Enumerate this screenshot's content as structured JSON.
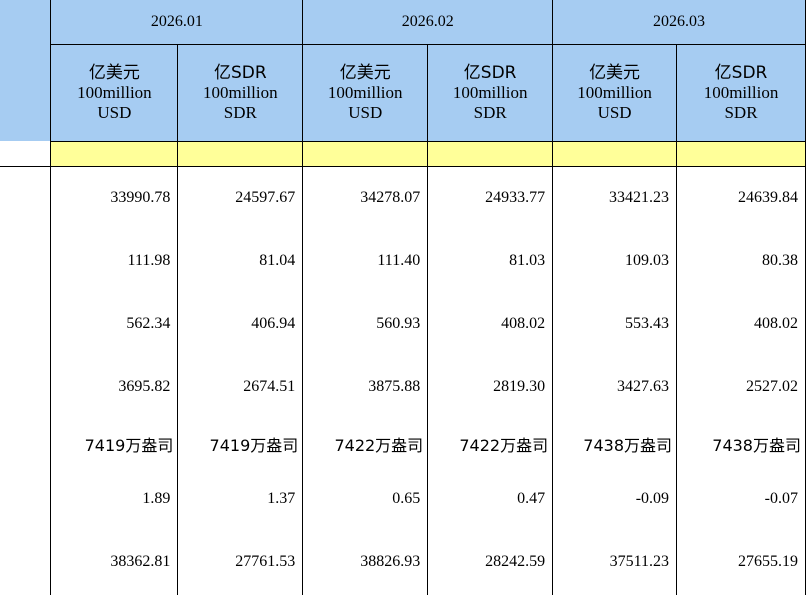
{
  "periods": [
    "2026.01",
    "2026.02",
    "2026.03"
  ],
  "units": {
    "usd": {
      "cn": "亿美元",
      "en1": "100million",
      "en2": "USD"
    },
    "sdr": {
      "cn": "亿SDR",
      "en1": "100million",
      "en2": "SDR"
    }
  },
  "rows": [
    [
      "33990.78",
      "24597.67",
      "34278.07",
      "24933.77",
      "33421.23",
      "24639.84"
    ],
    [
      "111.98",
      "81.04",
      "111.40",
      "81.03",
      "109.03",
      "80.38"
    ],
    [
      "562.34",
      "406.94",
      "560.93",
      "408.02",
      "553.43",
      "408.02"
    ],
    [
      "3695.82",
      "2674.51",
      "3875.88",
      "2819.30",
      "3427.63",
      "2527.02"
    ],
    [
      "7419万盎司",
      "7419万盎司",
      "7422万盎司",
      "7422万盎司",
      "7438万盎司",
      "7438万盎司"
    ],
    [
      "1.89",
      "1.37",
      "0.65",
      "0.47",
      "-0.09",
      "-0.07"
    ],
    [
      "38362.81",
      "27761.53",
      "38826.93",
      "28242.59",
      "37511.23",
      "27655.19"
    ]
  ],
  "colors": {
    "header_bg": "#a6ccf2",
    "band_bg": "#ffff99"
  }
}
